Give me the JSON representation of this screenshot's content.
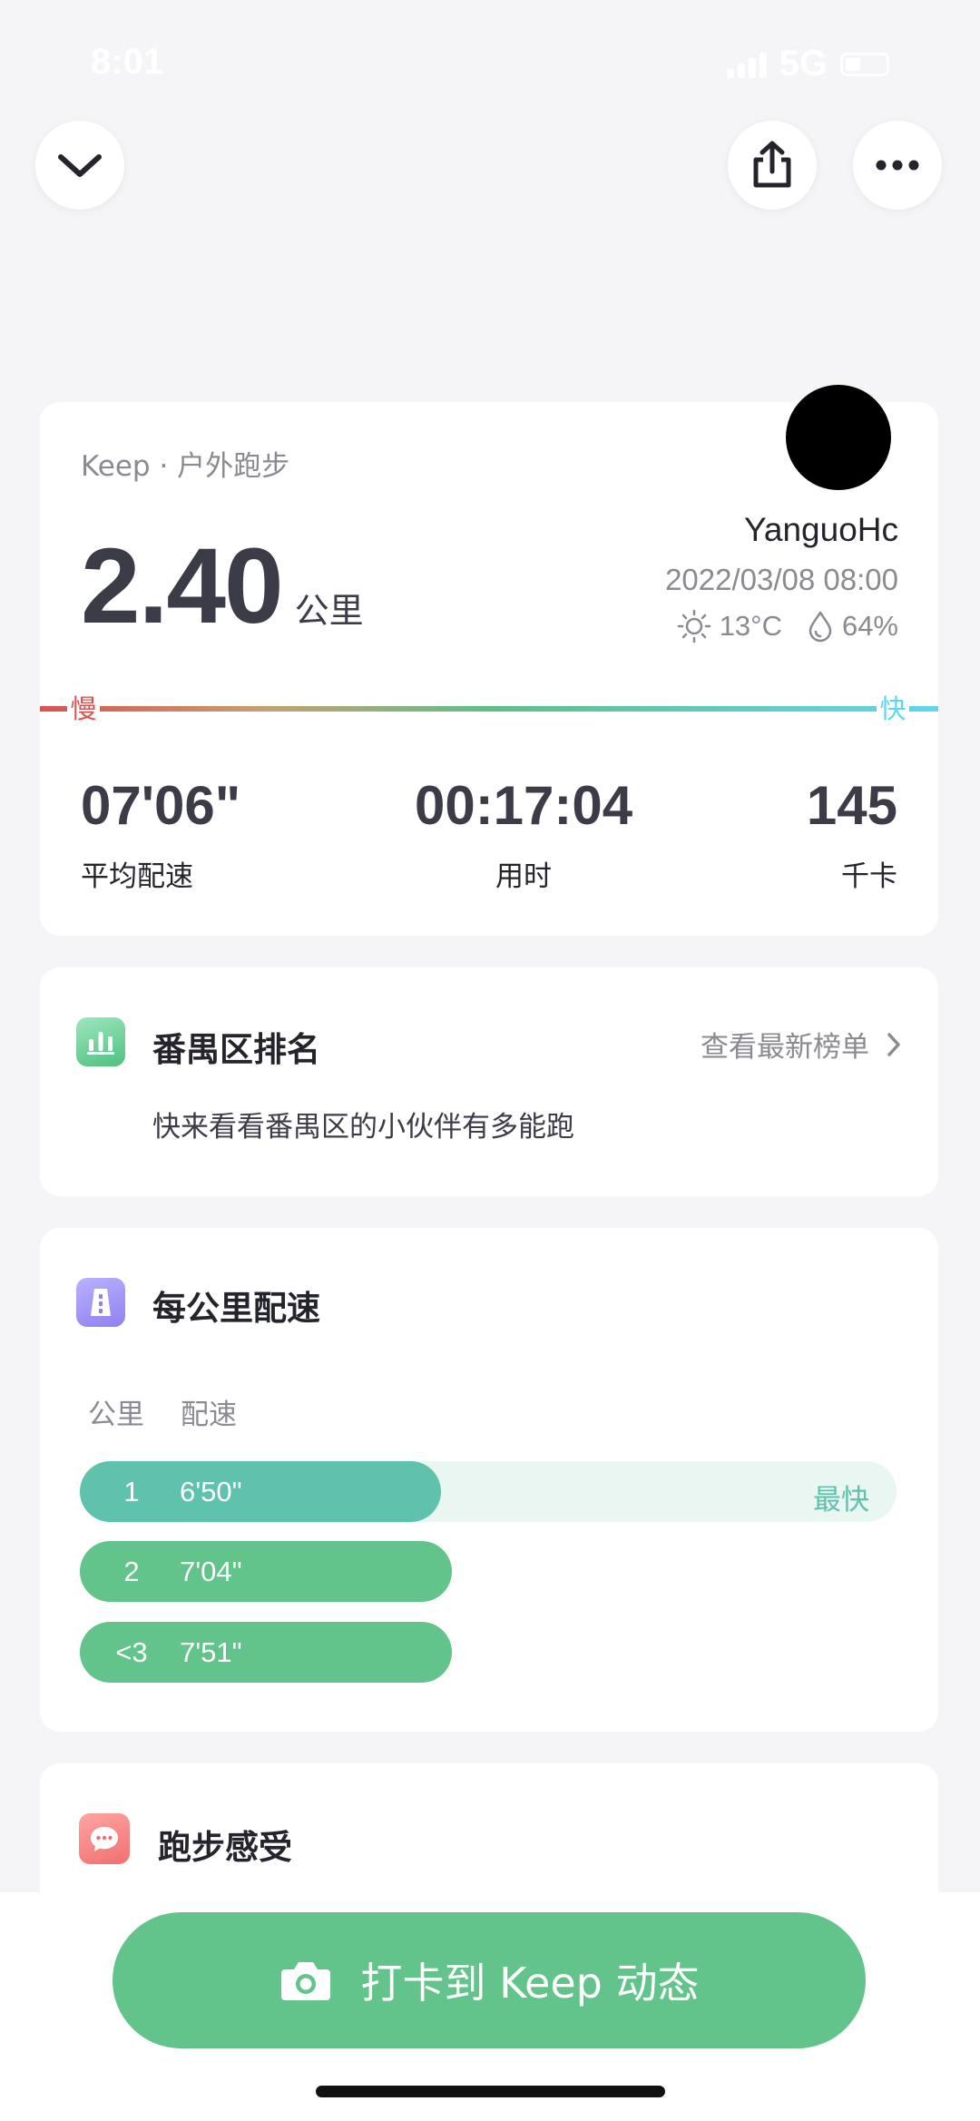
{
  "status_bar": {
    "time": "8:01",
    "network": "5G"
  },
  "header": {
    "collapse_icon": "chevron-down-icon",
    "share_icon": "share-icon",
    "more_icon": "more-icon"
  },
  "summary": {
    "source": "Keep · 户外跑步",
    "distance": "2.40",
    "distance_unit": "公里",
    "username": "YanguoHc",
    "datetime": "2022/03/08 08:00",
    "temperature": "13°C",
    "humidity": "64%",
    "pace_bar": {
      "slow_label": "慢",
      "fast_label": "快",
      "slow_color": "#d9534f",
      "mid_color": "#5fbf87",
      "fast_color": "#5fd6ee"
    },
    "stats": [
      {
        "value": "07'06\"",
        "label": "平均配速"
      },
      {
        "value": "00:17:04",
        "label": "用时"
      },
      {
        "value": "145",
        "label": "千卡"
      }
    ]
  },
  "ranking": {
    "title": "番禺区排名",
    "link_label": "查看最新榜单",
    "description": "快来看看番禺区的小伙伴有多能跑"
  },
  "splits": {
    "title": "每公里配速",
    "col_km": "公里",
    "col_pace": "配速",
    "fastest_label": "最快",
    "rows": [
      {
        "km": "1",
        "pace": "6'50\"",
        "fastest": true,
        "relative_speed": 1.0
      },
      {
        "km": "2",
        "pace": "7'04\"",
        "fastest": false,
        "relative_speed": 0.97
      },
      {
        "km": "<3",
        "pace": "7'51\"",
        "fastest": false,
        "relative_speed": 0.87
      }
    ]
  },
  "feeling": {
    "title": "跑步感受"
  },
  "checkin": {
    "label": "打卡到 Keep 动态",
    "icon": "camera-icon",
    "color": "#62c38b"
  }
}
